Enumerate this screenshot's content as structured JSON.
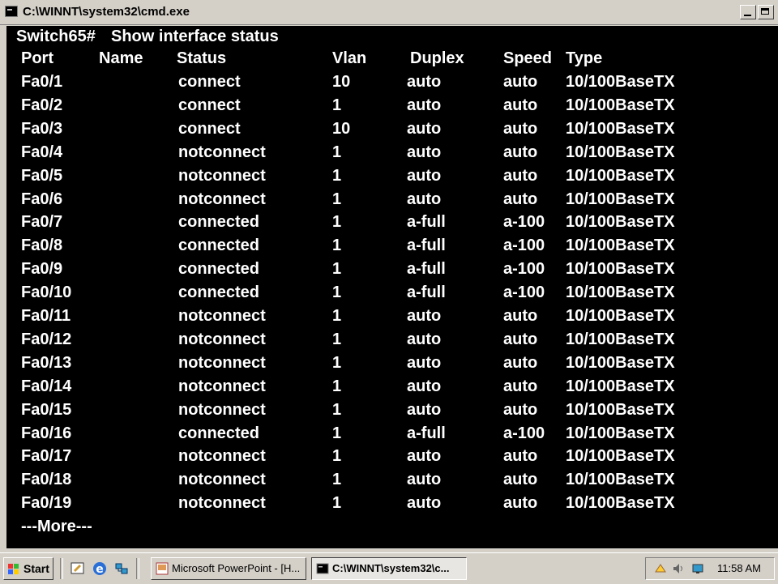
{
  "window": {
    "title": "C:\\WINNT\\system32\\cmd.exe"
  },
  "console": {
    "prompt": "Switch65#",
    "command": "Show interface status",
    "headers": [
      "Port",
      "Name",
      "Status",
      "Vlan",
      "Duplex",
      "Speed",
      "Type"
    ],
    "rows": [
      {
        "port": "Fa0/1",
        "name": "",
        "status": "connect",
        "vlan": "10",
        "duplex": "auto",
        "speed": "auto",
        "type": "10/100BaseTX"
      },
      {
        "port": "Fa0/2",
        "name": "",
        "status": "connect",
        "vlan": "1",
        "duplex": "auto",
        "speed": "auto",
        "type": "10/100BaseTX"
      },
      {
        "port": "Fa0/3",
        "name": "",
        "status": "connect",
        "vlan": "10",
        "duplex": "auto",
        "speed": "auto",
        "type": "10/100BaseTX"
      },
      {
        "port": "Fa0/4",
        "name": "",
        "status": "notconnect",
        "vlan": "1",
        "duplex": "auto",
        "speed": "auto",
        "type": "10/100BaseTX"
      },
      {
        "port": "Fa0/5",
        "name": "",
        "status": "notconnect",
        "vlan": "1",
        "duplex": "auto",
        "speed": "auto",
        "type": "10/100BaseTX"
      },
      {
        "port": "Fa0/6",
        "name": "",
        "status": "notconnect",
        "vlan": "1",
        "duplex": "auto",
        "speed": "auto",
        "type": "10/100BaseTX"
      },
      {
        "port": "Fa0/7",
        "name": "",
        "status": "connected",
        "vlan": "1",
        "duplex": "a-full",
        "speed": "a-100",
        "type": "10/100BaseTX"
      },
      {
        "port": "Fa0/8",
        "name": "",
        "status": "connected",
        "vlan": "1",
        "duplex": "a-full",
        "speed": "a-100",
        "type": "10/100BaseTX"
      },
      {
        "port": "Fa0/9",
        "name": "",
        "status": "connected",
        "vlan": "1",
        "duplex": "a-full",
        "speed": "a-100",
        "type": "10/100BaseTX"
      },
      {
        "port": "Fa0/10",
        "name": "",
        "status": "connected",
        "vlan": "1",
        "duplex": "a-full",
        "speed": "a-100",
        "type": "10/100BaseTX"
      },
      {
        "port": "Fa0/11",
        "name": "",
        "status": "notconnect",
        "vlan": "1",
        "duplex": "auto",
        "speed": "auto",
        "type": "10/100BaseTX"
      },
      {
        "port": "Fa0/12",
        "name": "",
        "status": "notconnect",
        "vlan": "1",
        "duplex": "auto",
        "speed": "auto",
        "type": "10/100BaseTX"
      },
      {
        "port": "Fa0/13",
        "name": "",
        "status": "notconnect",
        "vlan": "1",
        "duplex": "auto",
        "speed": "auto",
        "type": "10/100BaseTX"
      },
      {
        "port": "Fa0/14",
        "name": "",
        "status": "notconnect",
        "vlan": "1",
        "duplex": "auto",
        "speed": "auto",
        "type": "10/100BaseTX"
      },
      {
        "port": "Fa0/15",
        "name": "",
        "status": "notconnect",
        "vlan": "1",
        "duplex": "auto",
        "speed": "auto",
        "type": "10/100BaseTX"
      },
      {
        "port": "Fa0/16",
        "name": "",
        "status": "connected",
        "vlan": "1",
        "duplex": "a-full",
        "speed": "a-100",
        "type": "10/100BaseTX"
      },
      {
        "port": "Fa0/17",
        "name": "",
        "status": "notconnect",
        "vlan": "1",
        "duplex": "auto",
        "speed": "auto",
        "type": "10/100BaseTX"
      },
      {
        "port": "Fa0/18",
        "name": "",
        "status": "notconnect",
        "vlan": "1",
        "duplex": "auto",
        "speed": "auto",
        "type": "10/100BaseTX"
      },
      {
        "port": "Fa0/19",
        "name": "",
        "status": "notconnect",
        "vlan": "1",
        "duplex": "auto",
        "speed": "auto",
        "type": "10/100BaseTX"
      }
    ],
    "more": "---More---"
  },
  "taskbar": {
    "start_label": "Start",
    "quick_launch": [
      "desktop-icon",
      "outlook-icon",
      "internet-explorer-icon",
      "network-icon"
    ],
    "tasks": [
      {
        "label": "Microsoft PowerPoint - [H...",
        "icon": "powerpoint-icon",
        "active": false
      },
      {
        "label": "C:\\WINNT\\system32\\c...",
        "icon": "cmd-icon",
        "active": true
      }
    ],
    "tray_icons": [
      "network-tray-icon",
      "volume-icon",
      "display-icon"
    ],
    "clock": "11:58 AM"
  },
  "colors": {
    "console_bg": "#000000",
    "console_fg": "#ffffff",
    "chrome": "#d4d0c8"
  }
}
